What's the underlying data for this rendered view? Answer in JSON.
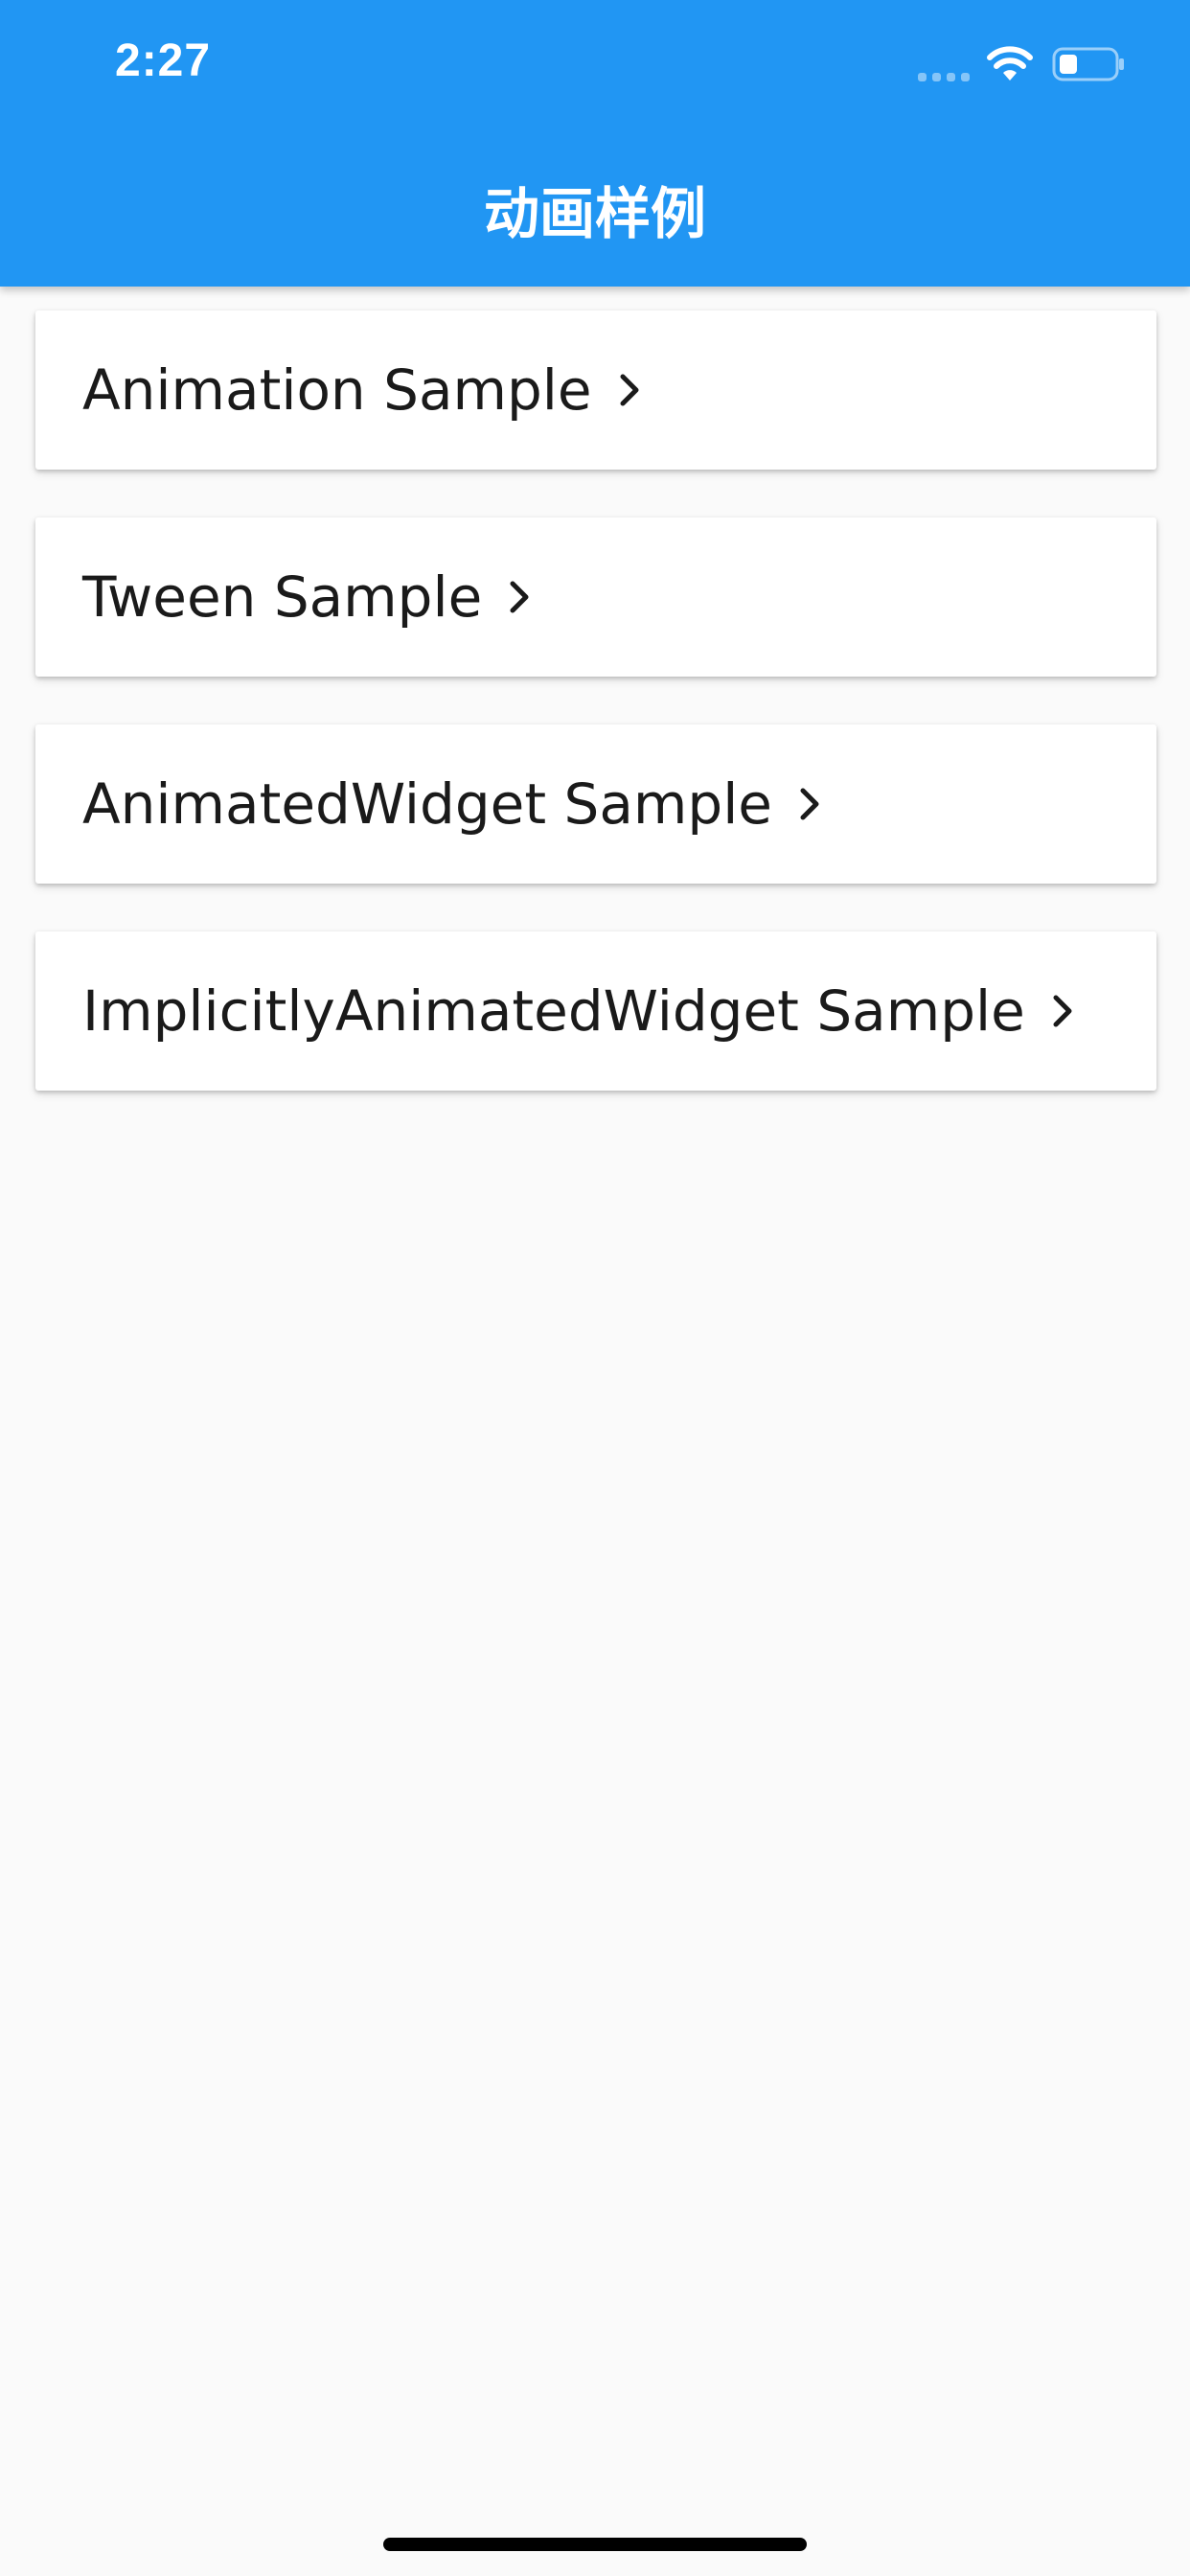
{
  "status_bar": {
    "time": "2:27",
    "signal_icon": "cellular-signal-icon",
    "wifi_icon": "wifi-icon",
    "battery_icon": "battery-icon"
  },
  "app_bar": {
    "title": "动画样例",
    "background_color": "#2196f3",
    "text_color": "#ffffff"
  },
  "list": {
    "items": [
      {
        "label": "Animation Sample",
        "icon": "chevron-right-icon"
      },
      {
        "label": "Tween Sample",
        "icon": "chevron-right-icon"
      },
      {
        "label": "AnimatedWidget Sample",
        "icon": "chevron-right-icon"
      },
      {
        "label": "ImplicitlyAnimatedWidget Sample",
        "icon": "chevron-right-icon"
      }
    ]
  },
  "colors": {
    "page_background": "#fafafa",
    "card_background": "#ffffff",
    "text": "#1a1a1a"
  }
}
